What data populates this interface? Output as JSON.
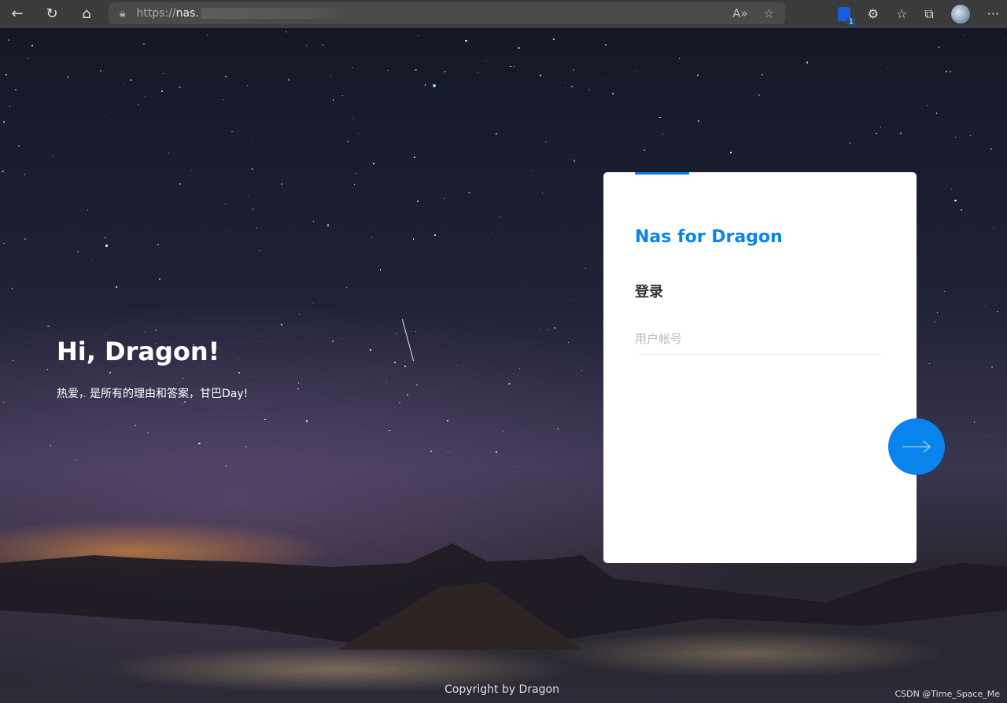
{
  "browser": {
    "url_scheme": "https://",
    "url_host": "nas.",
    "tab_badge": "1",
    "more_label": "···"
  },
  "hero": {
    "greeting": "Hi, Dragon!",
    "tagline": "热爱，是所有的理由和答案，甘巴Day!"
  },
  "login": {
    "title": "Nas for Dragon",
    "heading": "登录",
    "username_placeholder": "用户帐号",
    "username_value": ""
  },
  "footer": {
    "copyright": "Copyright by Dragon",
    "watermark": "CSDN @Time_Space_Me"
  },
  "colors": {
    "accent": "#0a84ed"
  }
}
